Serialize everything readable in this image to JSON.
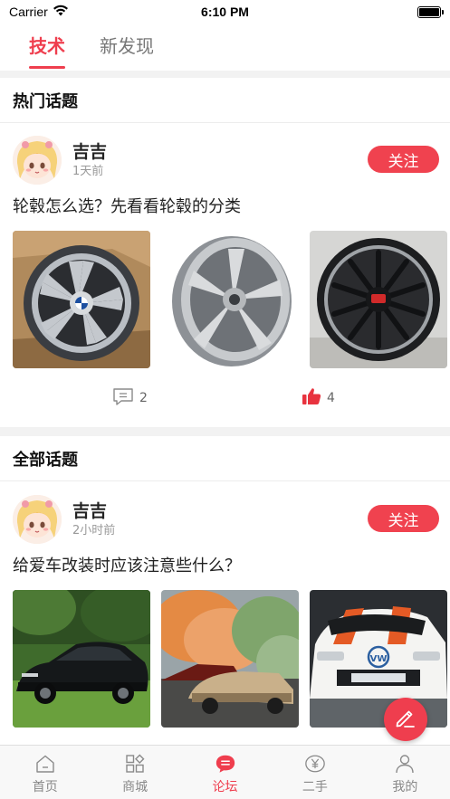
{
  "status_bar": {
    "carrier": "Carrier",
    "time": "6:10 PM",
    "battery_level": 1.0
  },
  "tabs": [
    {
      "label": "技术",
      "active": true
    },
    {
      "label": "新发现",
      "active": false
    }
  ],
  "hot_section": {
    "title": "热门话题",
    "post": {
      "user": "吉吉",
      "time": "1天前",
      "follow_label": "关注",
      "title": "轮毂怎么选？先看看轮毂的分类",
      "images": [
        "wheel-bmw-silver",
        "wheel-five-spoke-silver",
        "wheel-black-red-logo"
      ],
      "comments": "2",
      "likes": "4"
    }
  },
  "all_section": {
    "title": "全部话题",
    "post": {
      "user": "吉吉",
      "time": "2小时前",
      "follow_label": "关注",
      "title": "给爱车改装时应该注意些什么？",
      "images": [
        "car-black-bmw-coupe",
        "cars-colored-smoke",
        "car-white-vw-rally"
      ]
    }
  },
  "fab": {
    "icon": "pencil-icon"
  },
  "bottom_nav": [
    {
      "label": "首页",
      "icon": "home-icon",
      "active": false
    },
    {
      "label": "商城",
      "icon": "store-grid-icon",
      "active": false
    },
    {
      "label": "论坛",
      "icon": "forum-icon",
      "active": true
    },
    {
      "label": "二手",
      "icon": "yen-tag-icon",
      "active": false
    },
    {
      "label": "我的",
      "icon": "person-icon",
      "active": false
    }
  ],
  "colors": {
    "accent": "#ef3e4e",
    "follow": "#f0424f",
    "separator": "#f2f2f2"
  }
}
